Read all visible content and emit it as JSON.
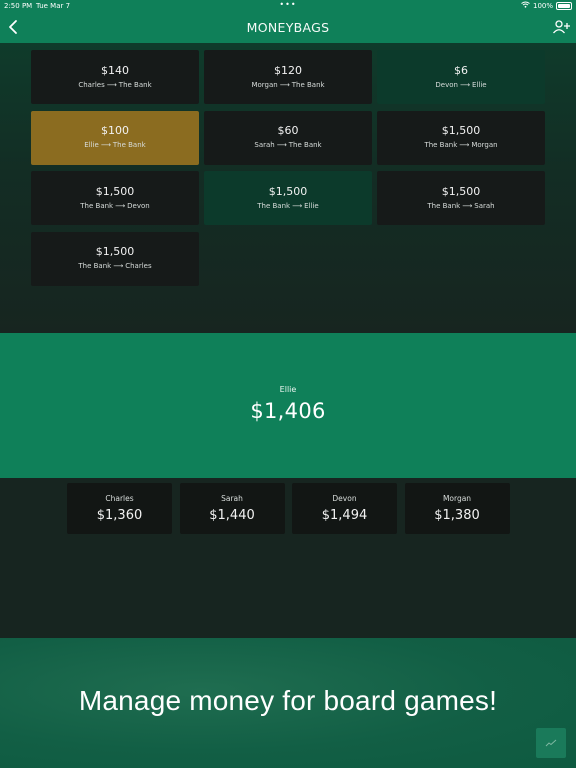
{
  "status_bar": {
    "time": "2:50 PM",
    "date": "Tue Mar 7",
    "dots": "•••",
    "battery_text": "100%"
  },
  "nav": {
    "title": "MONEYBAGS",
    "back_icon": "chevron-left-icon",
    "add_user_icon": "add-user-icon"
  },
  "transactions": [
    {
      "amount": "$140",
      "from": "Charles",
      "arrow": "⟶",
      "to": "The Bank",
      "style": "default"
    },
    {
      "amount": "$120",
      "from": "Morgan",
      "arrow": "⟶",
      "to": "The Bank",
      "style": "default"
    },
    {
      "amount": "$6",
      "from": "Devon",
      "arrow": "⟶",
      "to": "Ellie",
      "style": "green"
    },
    {
      "amount": "$100",
      "from": "Ellie",
      "arrow": "⟶",
      "to": "The Bank",
      "style": "accent"
    },
    {
      "amount": "$60",
      "from": "Sarah",
      "arrow": "⟶",
      "to": "The Bank",
      "style": "default"
    },
    {
      "amount": "$1,500",
      "from": "The Bank",
      "arrow": "⟶",
      "to": "Morgan",
      "style": "default"
    },
    {
      "amount": "$1,500",
      "from": "The Bank",
      "arrow": "⟶",
      "to": "Devon",
      "style": "default"
    },
    {
      "amount": "$1,500",
      "from": "The Bank",
      "arrow": "⟶",
      "to": "Ellie",
      "style": "green"
    },
    {
      "amount": "$1,500",
      "from": "The Bank",
      "arrow": "⟶",
      "to": "Sarah",
      "style": "default"
    },
    {
      "amount": "$1,500",
      "from": "The Bank",
      "arrow": "⟶",
      "to": "Charles",
      "style": "default"
    }
  ],
  "active_player": {
    "name": "Ellie",
    "balance": "$1,406"
  },
  "players": [
    {
      "name": "Charles",
      "balance": "$1,360"
    },
    {
      "name": "Sarah",
      "balance": "$1,440"
    },
    {
      "name": "Devon",
      "balance": "$1,494"
    },
    {
      "name": "Morgan",
      "balance": "$1,380"
    }
  ],
  "promo": {
    "text": "Manage money for board games!"
  },
  "floating_button": {
    "icon": "chart-line-icon"
  },
  "colors": {
    "brand_green": "#0f8059",
    "card_dark": "#161a19",
    "accent_gold": "#8b6c20",
    "card_green": "#0c3a2b"
  }
}
